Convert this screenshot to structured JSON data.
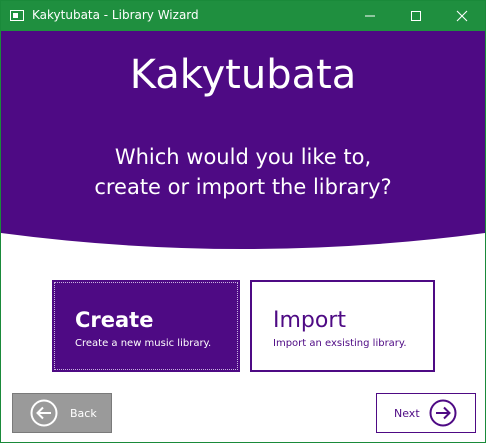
{
  "window": {
    "title": "Kakytubata - Library Wizard",
    "controls": [
      "minimize-icon",
      "maximize-icon",
      "close-icon"
    ]
  },
  "header": {
    "app_name": "Kakytubata",
    "question_line1": "Which would you like to,",
    "question_line2": "create or import the library?"
  },
  "options": {
    "create": {
      "title": "Create",
      "description": "Create a new music library.",
      "selected": true
    },
    "import": {
      "title": "Import",
      "description": "Import an exsisting library.",
      "selected": false
    }
  },
  "navigation": {
    "back_label": "Back",
    "back_icon": "arrow-left-circle-icon",
    "back_enabled": false,
    "next_label": "Next",
    "next_icon": "arrow-right-circle-icon"
  },
  "colors": {
    "titlebar": "#1f8f3f",
    "accent": "#4e0a84",
    "disabled": "#9a9a9a"
  }
}
